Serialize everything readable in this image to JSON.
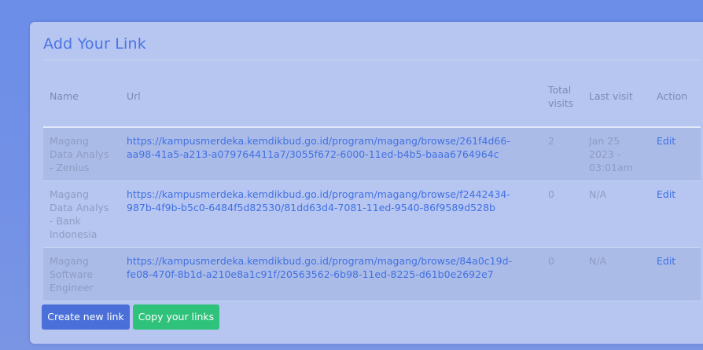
{
  "card": {
    "title": "Add Your Link"
  },
  "table": {
    "headers": {
      "name": "Name",
      "url": "Url",
      "total_visits": "Total visits",
      "last_visit": "Last visit",
      "action": "Action"
    },
    "rows": [
      {
        "name": "Magang Data Analys - Zenius",
        "url": "https://kampusmerdeka.kemdikbud.go.id/program/magang/browse/261f4d66-aa98-41a5-a213-a079764411a7/3055f672-6000-11ed-b4b5-baaa6764964c",
        "total_visits": "2",
        "last_visit": "Jan 25 2023 - 03:01am",
        "action": "Edit"
      },
      {
        "name": "Magang Data Analys - Bank Indonesia",
        "url": "https://kampusmerdeka.kemdikbud.go.id/program/magang/browse/f2442434-987b-4f9b-b5c0-6484f5d82530/81dd63d4-7081-11ed-9540-86f9589d528b",
        "total_visits": "0",
        "last_visit": "N/A",
        "action": "Edit"
      },
      {
        "name": "Magang Software Engineer",
        "url": "https://kampusmerdeka.kemdikbud.go.id/program/magang/browse/84a0c19d-fe08-470f-8b1d-a210e8a1c91f/20563562-6b98-11ed-8225-d61b0e2692e7",
        "total_visits": "0",
        "last_visit": "N/A",
        "action": "Edit"
      }
    ]
  },
  "buttons": {
    "create_label": "Create new link",
    "copy_label": "Copy your links"
  },
  "colors": {
    "page_background": "#6f8fe6",
    "card_background": "#b6c6f1",
    "accent": "#4170e2",
    "create_button": "#4a6fd8",
    "copy_button": "#2fc27a"
  }
}
